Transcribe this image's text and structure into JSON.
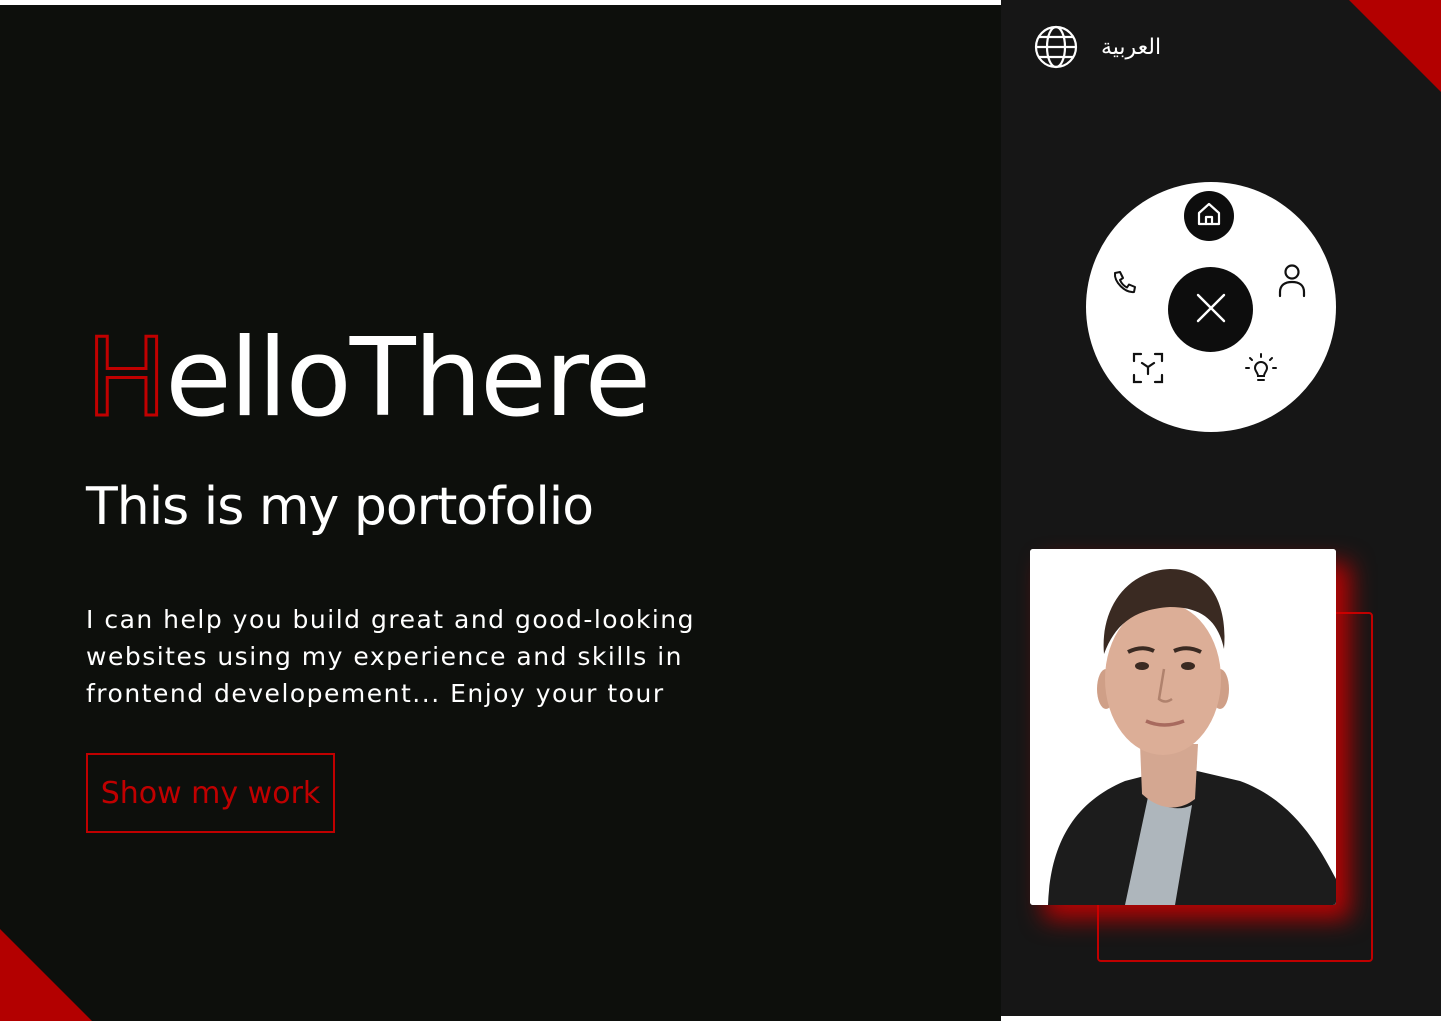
{
  "hero": {
    "title_first_letter": "H",
    "title_rest": "elloThere",
    "subtitle": "This is my portofolio",
    "description": "I can help you build great and good-looking websites using my experience and skills in frontend developement... Enjoy your tour",
    "cta_label": "Show my work"
  },
  "sidebar": {
    "language_label": "العربية",
    "language_icon": "globe-icon",
    "radial_menu": {
      "items": [
        {
          "name": "home",
          "icon": "home-icon",
          "active": true
        },
        {
          "name": "about",
          "icon": "user-icon",
          "active": false
        },
        {
          "name": "skills",
          "icon": "lightbulb-icon",
          "active": false
        },
        {
          "name": "projects",
          "icon": "cube-scan-icon",
          "active": false
        },
        {
          "name": "contact",
          "icon": "phone-icon",
          "active": false
        }
      ],
      "close_icon": "close-icon"
    },
    "profile_photo": "avatar"
  },
  "colors": {
    "accent": "#c00000",
    "main_bg": "#0d0f0c",
    "sidebar_bg": "#161616",
    "text": "#ffffff"
  }
}
